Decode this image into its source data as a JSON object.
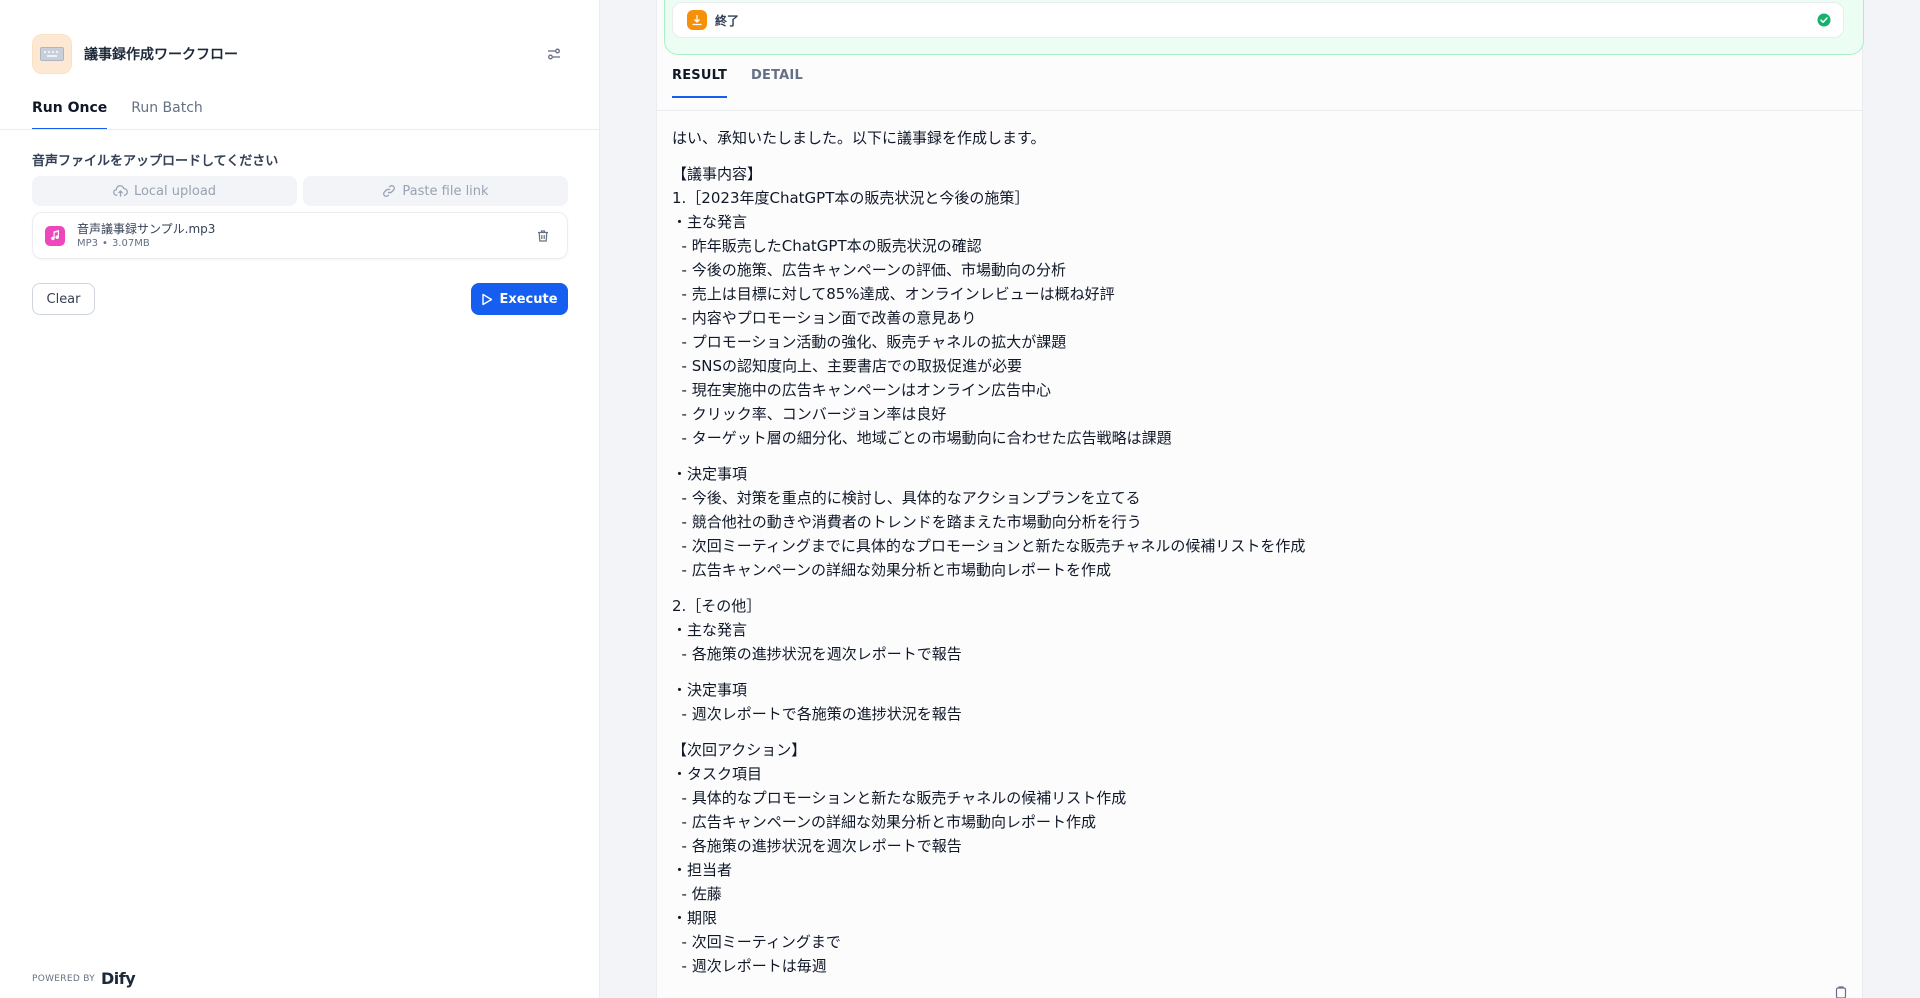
{
  "app": {
    "title": "議事録作成ワークフロー",
    "tabs": [
      "Run Once",
      "Run Batch"
    ]
  },
  "form": {
    "label": "音声ファイルをアップロードしてください",
    "local_upload": "Local upload",
    "paste_link": "Paste file link",
    "file": {
      "name": "音声議事録サンプル.mp3",
      "type": "MP3",
      "separator": "•",
      "size": "3.07MB"
    },
    "clear_label": "Clear",
    "execute_label": "Execute"
  },
  "footer": {
    "powered_by": "POWERED BY",
    "brand": "Dify"
  },
  "workflow": {
    "node_title": "終了",
    "node_status": "success"
  },
  "result": {
    "tabs": [
      "RESULT",
      "DETAIL"
    ],
    "intro": "はい、承知いたしました。以下に議事録を作成します。",
    "section1": [
      "【議事内容】",
      "1.［2023年度ChatGPT本の販売状況と今後の施策］",
      "・主な発言",
      "  - 昨年販売したChatGPT本の販売状況の確認",
      "  - 今後の施策、広告キャンペーンの評価、市場動向の分析",
      "  - 売上は目標に対して85%達成、オンラインレビューは概ね好評",
      "  - 内容やプロモーション面で改善の意見あり",
      "  - プロモーション活動の強化、販売チャネルの拡大が課題",
      "  - SNSの認知度向上、主要書店での取扱促進が必要",
      "  - 現在実施中の広告キャンペーンはオンライン広告中心",
      "  - クリック率、コンバージョン率は良好",
      "  - ターゲット層の細分化、地域ごとの市場動向に合わせた広告戦略は課題"
    ],
    "section2": [
      "・決定事項",
      "  - 今後、対策を重点的に検討し、具体的なアクションプランを立てる",
      "  - 競合他社の動きや消費者のトレンドを踏まえた市場動向分析を行う",
      "  - 次回ミーティングまでに具体的なプロモーションと新たな販売チャネルの候補リストを作成",
      "  - 広告キャンペーンの詳細な効果分析と市場動向レポートを作成"
    ],
    "section3": [
      "2.［その他］",
      "・主な発言",
      "  - 各施策の進捗状況を週次レポートで報告"
    ],
    "section4": [
      "・決定事項",
      "  - 週次レポートで各施策の進捗状況を報告"
    ],
    "section5": [
      "【次回アクション】",
      "・タスク項目",
      "  - 具体的なプロモーションと新たな販売チャネルの候補リスト作成",
      "  - 広告キャンペーンの詳細な効果分析と市場動向レポート作成",
      "  - 各施策の進捗状況を週次レポートで報告",
      "・担当者",
      "  - 佐藤",
      "・期限",
      "  - 次回ミーティングまで",
      "  - 週次レポートは毎週"
    ]
  },
  "icons": {
    "app": "keyboard-icon",
    "settings": "sliders-icon",
    "upload": "cloud-upload-icon",
    "link": "link-icon",
    "file": "music-note-icon",
    "delete": "trash-icon",
    "play": "play-icon",
    "end_node": "end-node-icon",
    "status": "check-circle-icon",
    "copy": "clipboard-icon"
  },
  "colors": {
    "accent": "#155eef",
    "success": "#17b26a",
    "end_node": "#f79009",
    "file_icon": "#ee46bc"
  }
}
